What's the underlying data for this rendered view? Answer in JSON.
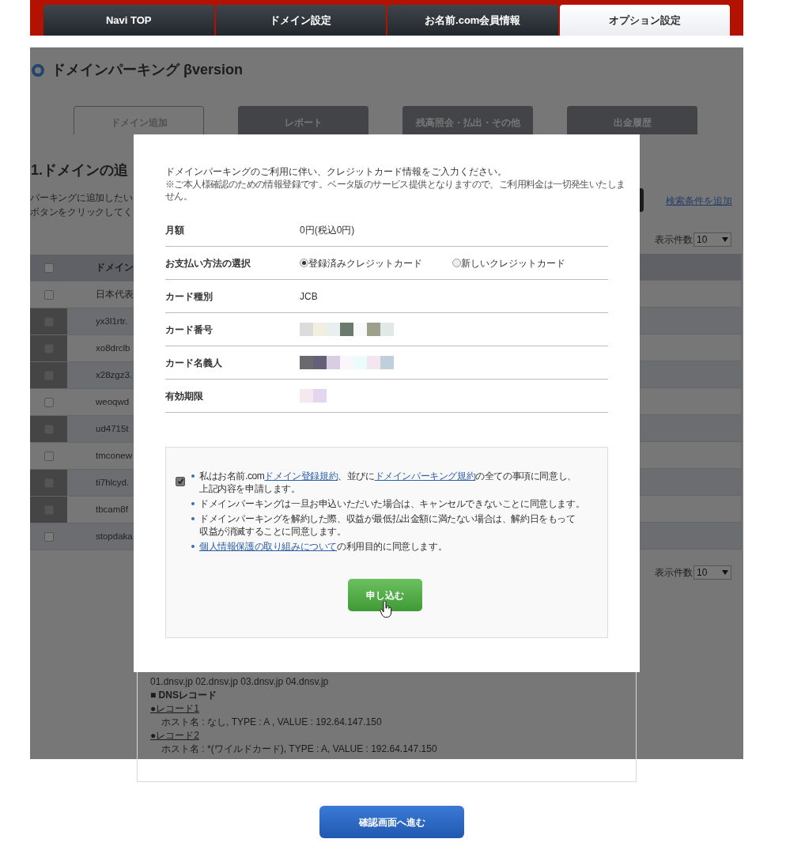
{
  "nav_tabs": [
    {
      "label": "Navi TOP",
      "selected": false
    },
    {
      "label": "ドメイン設定",
      "selected": false
    },
    {
      "label": "お名前.com会員情報",
      "selected": false
    },
    {
      "label": "オプション設定",
      "selected": true
    }
  ],
  "page_title": "ドメインパーキング βversion",
  "sub_tabs": [
    {
      "label": "ドメイン追加",
      "selected": true
    },
    {
      "label": "レポート",
      "selected": false
    },
    {
      "label": "残高照会・払出・その他",
      "selected": false
    },
    {
      "label": "出金履歴",
      "selected": false
    }
  ],
  "section_heading": "1.ドメインの追",
  "instructions": [
    "パーキングに追加したい",
    "ボタンをクリックしてく"
  ],
  "search_link": "検索条件を追加",
  "page_size_top": {
    "label": "表示件数",
    "value": "10"
  },
  "page_size_bottom": {
    "label": "表示件数",
    "value": "10"
  },
  "table": {
    "header": "ドメイン",
    "header_checked": false,
    "rows": [
      {
        "domain": "日本代表",
        "disabled": false,
        "checked": false
      },
      {
        "domain": "yx3l1rtr.",
        "disabled": true,
        "checked": false
      },
      {
        "domain": "xo8drclb",
        "disabled": true,
        "checked": false
      },
      {
        "domain": "x28zgz3.",
        "disabled": true,
        "checked": false
      },
      {
        "domain": "weoqwd",
        "disabled": false,
        "checked": false
      },
      {
        "domain": "ud4715t",
        "disabled": true,
        "checked": false
      },
      {
        "domain": "tmconew",
        "disabled": false,
        "checked": false
      },
      {
        "domain": "ti7hlcyd.",
        "disabled": true,
        "checked": false
      },
      {
        "domain": "tbcam8f",
        "disabled": true,
        "checked": false
      },
      {
        "domain": "stopdaka",
        "disabled": false,
        "checked": false
      }
    ]
  },
  "dns_info": [
    {
      "kind": "text",
      "text": "01.dnsv.jp 02.dnsv.jp 03.dnsv.jp 04.dnsv.jp"
    },
    {
      "kind": "heading",
      "text": "■ DNSレコード"
    },
    {
      "kind": "link",
      "text": "●レコード1"
    },
    {
      "kind": "indent",
      "text": "ホスト名 : なし, TYPE : A , VALUE : 192.64.147.150"
    },
    {
      "kind": "link",
      "text": "●レコード2"
    },
    {
      "kind": "indent",
      "text": "ホスト名 : *(ワイルドカード), TYPE : A, VALUE : 192.64.147.150"
    }
  ],
  "confirm_button": "確認画面へ進む",
  "modal": {
    "intro": "ドメインパーキングのご利用に伴い、クレジットカード情報をご入力ください。",
    "note": "※ご本人様確認のための情報登録です。ベータ版のサービス提供となりますので、ご利用料金は一切発生いたしません。",
    "rows": [
      {
        "label": "月額",
        "kind": "text",
        "value": "0円(税込0円)"
      },
      {
        "label": "お支払い方法の選択",
        "kind": "radio",
        "options": [
          {
            "label": "登録済みクレジットカード",
            "selected": true
          },
          {
            "label": "新しいクレジットカード",
            "selected": false
          }
        ]
      },
      {
        "label": "カード種別",
        "kind": "text",
        "value": "JCB"
      },
      {
        "label": "カード番号",
        "kind": "masked"
      },
      {
        "label": "カード名義人",
        "kind": "masked"
      },
      {
        "label": "有効期限",
        "kind": "masked"
      }
    ],
    "agree_checked": true,
    "terms": [
      {
        "lines": [
          [
            {
              "kind": "text",
              "text": "私はお名前.com"
            },
            {
              "kind": "link",
              "text": "ドメイン登録規約"
            },
            {
              "kind": "text",
              "text": "、並びに"
            },
            {
              "kind": "link",
              "text": "ドメインパーキング規約"
            },
            {
              "kind": "text",
              "text": "の全ての事項に同意し、"
            }
          ],
          [
            {
              "kind": "text",
              "text": "上記内容を申請します。"
            }
          ]
        ]
      },
      {
        "lines": [
          [
            {
              "kind": "text",
              "text": "ドメインパーキングは一旦お申込いただいた場合は、キャンセルできないことに同意します。"
            }
          ]
        ]
      },
      {
        "lines": [
          [
            {
              "kind": "text",
              "text": "ドメインパーキングを解約した際、収益が最低払出金額に満たない場合は、解約日をもって"
            }
          ],
          [
            {
              "kind": "text",
              "text": "収益が消滅することに同意します。"
            }
          ]
        ]
      },
      {
        "lines": [
          [
            {
              "kind": "link",
              "text": "個人情報保護の取り組みについて"
            },
            {
              "kind": "text",
              "text": "の利用目的に同意します。"
            }
          ]
        ]
      }
    ],
    "submit": "申し込む"
  }
}
